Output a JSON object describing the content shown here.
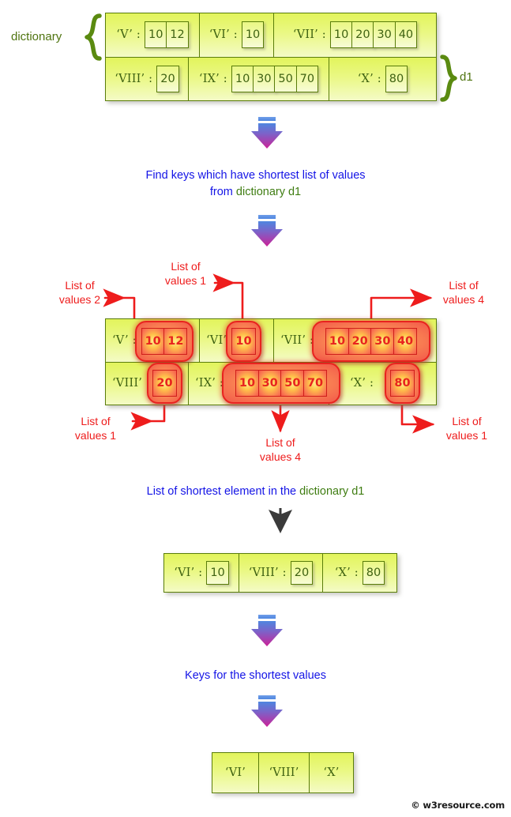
{
  "labels": {
    "dictionary": "dictionary",
    "d1": "d1",
    "watermark": "© w3resource.com"
  },
  "dictionary": {
    "rows": [
      [
        {
          "key": "‘V’ :",
          "values": [
            "10",
            "12"
          ]
        },
        {
          "key": "‘VI’ :",
          "values": [
            "10"
          ]
        },
        {
          "key": "‘VII’ :",
          "values": [
            "10",
            "20",
            "30",
            "40"
          ]
        }
      ],
      [
        {
          "key": "‘VIII’ :",
          "values": [
            "20"
          ]
        },
        {
          "key": "‘IX’ :",
          "values": [
            "10",
            "30",
            "50",
            "70"
          ]
        },
        {
          "key": "‘X’ :",
          "values": [
            "80"
          ]
        }
      ]
    ]
  },
  "step1_text": {
    "line1": "Find keys which have shortest list of values",
    "line2_prefix": "from ",
    "line2_green": "dictionary d1"
  },
  "highlight": {
    "rows": [
      [
        {
          "key": "‘V’ :",
          "values": [
            "10",
            "12"
          ]
        },
        {
          "key": "‘VI’ :",
          "values": [
            "10"
          ]
        },
        {
          "key": "‘VII’ :",
          "values": [
            "10",
            "20",
            "30",
            "40"
          ]
        }
      ],
      [
        {
          "key": "‘VIII’ :",
          "values": [
            "20"
          ]
        },
        {
          "key": "‘IX’ :",
          "values": [
            "10",
            "30",
            "50",
            "70"
          ]
        },
        {
          "key": "‘X’ :",
          "values": [
            "80"
          ]
        }
      ]
    ],
    "annotations": [
      {
        "id": "list-of-values-2-v",
        "line1": "List of",
        "line2": "values 2"
      },
      {
        "id": "list-of-values-1-vi",
        "line1": "List of",
        "line2": "values 1"
      },
      {
        "id": "list-of-values-4-vii",
        "line1": "List of",
        "line2": "values 4"
      },
      {
        "id": "list-of-values-1-viii",
        "line1": "List of",
        "line2": "values 1"
      },
      {
        "id": "list-of-values-4-ix",
        "line1": "List of",
        "line2": "values 4"
      },
      {
        "id": "list-of-values-1-x",
        "line1": "List of",
        "line2": "values 1"
      }
    ]
  },
  "step2_text": {
    "prefix": "List of shortest element in the ",
    "green": "dictionary d1"
  },
  "shortest_elements": [
    {
      "key": "‘VI’ :",
      "value": "10"
    },
    {
      "key": "‘VIII’ :",
      "value": "20"
    },
    {
      "key": "‘X’ :",
      "value": "80"
    }
  ],
  "step3_text": {
    "line1": "Keys for the shortest values"
  },
  "result_keys": [
    "‘VI’",
    "‘VIII’",
    "‘X’"
  ],
  "colors": {
    "box_border": "#5a7d0a",
    "box_fill": "#e9f58a",
    "key_text": "#3f6212",
    "highlight_red": "#e8231f",
    "blue_text": "#1414e6",
    "green_text": "#3f7d12",
    "arrow_top": "#4f86e0",
    "arrow_mid": "#7b63c9",
    "arrow_bottom": "#cc2298"
  }
}
